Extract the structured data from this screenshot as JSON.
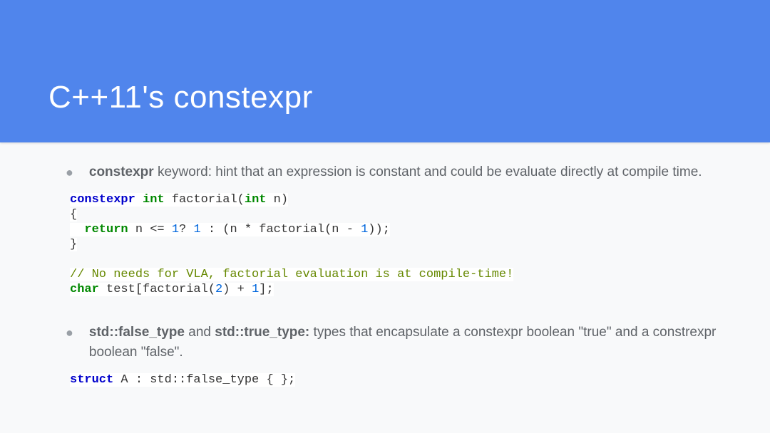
{
  "header": {
    "title": "C++11's constexpr"
  },
  "bullets": [
    {
      "bold": "constexpr",
      "rest": " keyword: hint that an expression is constant and could be evaluate directly at compile time."
    },
    {
      "bold1": "std::false_type",
      "mid1": " and ",
      "bold2": "std::true_type:",
      "rest": " types that encapsulate a constexpr boolean \"true\" and a constrexpr boolean \"false\"."
    }
  ],
  "code1": {
    "l1_kw1": "constexpr",
    "l1_kw2": "int",
    "l1_fn": "factorial(",
    "l1_kw3": "int",
    "l1_rest": " n)",
    "l2": "{",
    "l3_kw": "return",
    "l3_a": " n <= ",
    "l3_n1": "1",
    "l3_b": "? ",
    "l3_n2": "1",
    "l3_c": " : (n * factorial(n - ",
    "l3_n3": "1",
    "l3_d": "));",
    "l4": "}",
    "l6_comment": "// No needs for VLA, factorial evaluation is at compile-time!",
    "l7_kw": "char",
    "l7_a": " test[factorial(",
    "l7_n1": "2",
    "l7_b": ") + ",
    "l7_n2": "1",
    "l7_c": "];"
  },
  "code2": {
    "l1_kw": "struct",
    "l1_rest": " A : std::false_type { };"
  }
}
